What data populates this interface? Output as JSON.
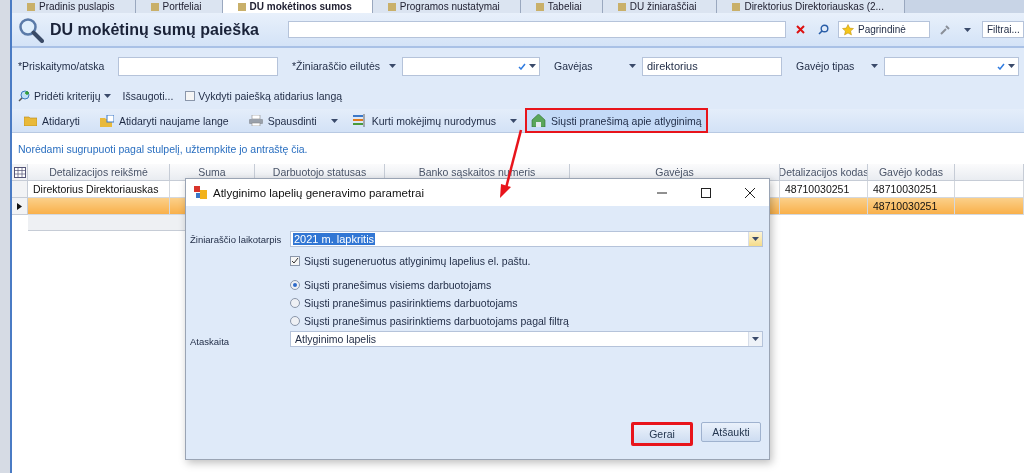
{
  "tabs": [
    {
      "label": "Pradinis puslapis",
      "selected": false
    },
    {
      "label": "Portfeliai",
      "selected": false
    },
    {
      "label": "DU mokėtinos sumos",
      "selected": true
    },
    {
      "label": "Programos nustatymai",
      "selected": false
    },
    {
      "label": "Tabeliai",
      "selected": false
    },
    {
      "label": "DU žiniaraščiai",
      "selected": false
    },
    {
      "label": "Direktorius Direktoriauskas (2...",
      "selected": false
    }
  ],
  "header": {
    "title": "DU mokėtinų sumų paieška",
    "favorites": "Pagrindinė",
    "filter": "Filtrai..."
  },
  "criteria": [
    {
      "label": "*Priskaitymo/atska",
      "kind": "text"
    },
    {
      "label": "*Žiniaraščio eilutės",
      "kind": "combo"
    },
    {
      "label": "Gavėjas",
      "kind": "text",
      "value": "direktorius"
    },
    {
      "label": "Gavėjo tipas",
      "kind": "combo"
    }
  ],
  "criteria_actions": {
    "add": "Pridėti kriterijų",
    "save": "Išsaugoti...",
    "run_on_open": {
      "label": "Vykdyti paiešką atidarius langą",
      "checked": false
    }
  },
  "toolbar": [
    {
      "label": "Atidaryti",
      "dropdown": false,
      "highlighted": false
    },
    {
      "label": "Atidaryti naujame lange",
      "dropdown": false,
      "highlighted": false
    },
    {
      "label": "Spausdinti",
      "dropdown": true,
      "highlighted": false
    },
    {
      "label": "Kurti mokėjimų nurodymus",
      "dropdown": true,
      "highlighted": false
    },
    {
      "label": "Siųsti pranešimą apie atlyginimą",
      "dropdown": false,
      "highlighted": true
    }
  ],
  "grid": {
    "group_hint": "Norėdami sugrupuoti pagal stulpelį, užtempkite jo antraštę čia.",
    "columns": [
      {
        "label": "Detalizacijos reikšmė"
      },
      {
        "label": "Suma"
      },
      {
        "label": "Darbuotojo statusas"
      },
      {
        "label": "Banko sąskaitos numeris"
      },
      {
        "label": "Gavėjas"
      },
      {
        "label": "Detalizacijos kodas"
      },
      {
        "label": "Gavėjo kodas"
      },
      {}
    ],
    "rows": [
      {
        "selected": false,
        "cells": [
          {
            "text": "Direktorius Direktoriauskas"
          },
          {},
          {},
          {},
          {},
          {
            "text": "48710030251"
          },
          {
            "text": "48710030251"
          },
          {}
        ]
      },
      {
        "selected": true,
        "cells": [
          {},
          {},
          {},
          {},
          {},
          {},
          {
            "text": "48710030251"
          },
          {}
        ]
      }
    ]
  },
  "dialog": {
    "title": "Atlyginimo lapelių generavimo parametrai",
    "period": {
      "label": "Žiniaraščio laikotarpis",
      "value": "2021 m. lapkritis"
    },
    "send_email": {
      "label": "Siųsti sugeneruotus atlyginimų lapelius el. paštu.",
      "checked": true
    },
    "recipients": [
      {
        "label": "Siųsti pranešimus visiems darbuotojams",
        "selected": true
      },
      {
        "label": "Siųsti pranešimus pasirinktiems darbuotojams",
        "selected": false
      },
      {
        "label": "Siųsti pranešimus pasirinktiems darbuotojams pagal filtrą",
        "selected": false
      }
    ],
    "report": {
      "label": "Ataskaita",
      "value": "Atlyginimo lapelis"
    },
    "buttons": [
      {
        "label": "Gerai",
        "highlighted": true
      },
      {
        "label": "Atšaukti",
        "highlighted": false
      }
    ]
  }
}
